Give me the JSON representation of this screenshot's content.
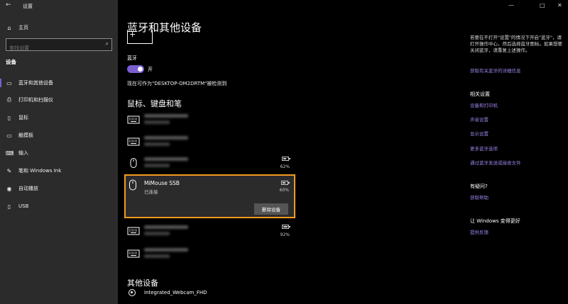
{
  "window": {
    "back_glyph": "←",
    "title": "设置",
    "minimize": "—",
    "maximize": "□",
    "close": "✕"
  },
  "sidebar": {
    "home_label": "主页",
    "search_placeholder": "查找设置",
    "section_title": "设备",
    "items": [
      {
        "label": "蓝牙和其他设备",
        "icon": "bluetooth-devices-icon"
      },
      {
        "label": "打印机和扫描仪",
        "icon": "printer-icon"
      },
      {
        "label": "鼠标",
        "icon": "mouse-icon"
      },
      {
        "label": "触摸板",
        "icon": "touchpad-icon"
      },
      {
        "label": "输入",
        "icon": "keyboard-icon"
      },
      {
        "label": "笔和 Windows Ink",
        "icon": "pen-icon"
      },
      {
        "label": "自动播放",
        "icon": "autoplay-icon"
      },
      {
        "label": "USB",
        "icon": "usb-icon"
      }
    ]
  },
  "main": {
    "title": "蓝牙和其他设备",
    "add_glyph": "+",
    "bluetooth_label": "蓝牙",
    "toggle_state": "开",
    "discoverable_text": "现在可作为\"DESKTOP-OM2DRTM\"被检测到",
    "mouse_section_title": "鼠标、键盘和笔",
    "devices": [
      {
        "type": "keyboard",
        "icon": "keyboard-icon",
        "battery": ""
      },
      {
        "type": "keyboard",
        "icon": "keyboard-icon",
        "battery": ""
      },
      {
        "type": "mouse",
        "icon": "mouse-icon",
        "battery": "62%",
        "battery_level": 0.62
      },
      {
        "type": "keyboard",
        "icon": "keyboard-icon",
        "battery": "92%",
        "battery_level": 0.92
      },
      {
        "type": "keyboard",
        "icon": "keyboard-icon",
        "battery": ""
      }
    ],
    "selected_device": {
      "name": "MiMouse SSB",
      "status": "已连接",
      "battery": "60%",
      "battery_level": 0.6,
      "remove_label": "删除设备",
      "highlight_color": "#f39a1e"
    },
    "other_section_title": "其他设备",
    "other_devices": [
      {
        "name": "Integrated_Webcam_FHD",
        "icon": "webcam-icon"
      }
    ]
  },
  "right": {
    "tip_text": "若要在不打开\"设置\"的情况下开启\"蓝牙\"，请打开操作中心，然后选择蓝牙图标。如果想要关闭蓝牙，请重复上述操作。",
    "tip_link": "获取有关蓝牙的详细信息",
    "related_title": "相关设置",
    "related_links": [
      "设备和打印机",
      "声音设置",
      "显示设置",
      "更多蓝牙选项",
      "通过蓝牙发送或接收文件"
    ],
    "help_title": "有疑问?",
    "help_link": "获取帮助",
    "improve_title": "让 Windows 变得更好",
    "improve_link": "提供反馈"
  },
  "colors": {
    "accent": "#7a5fd0",
    "link": "#9c84e8",
    "sidebar_bg": "#2b2b2b",
    "main_bg": "#000000"
  }
}
